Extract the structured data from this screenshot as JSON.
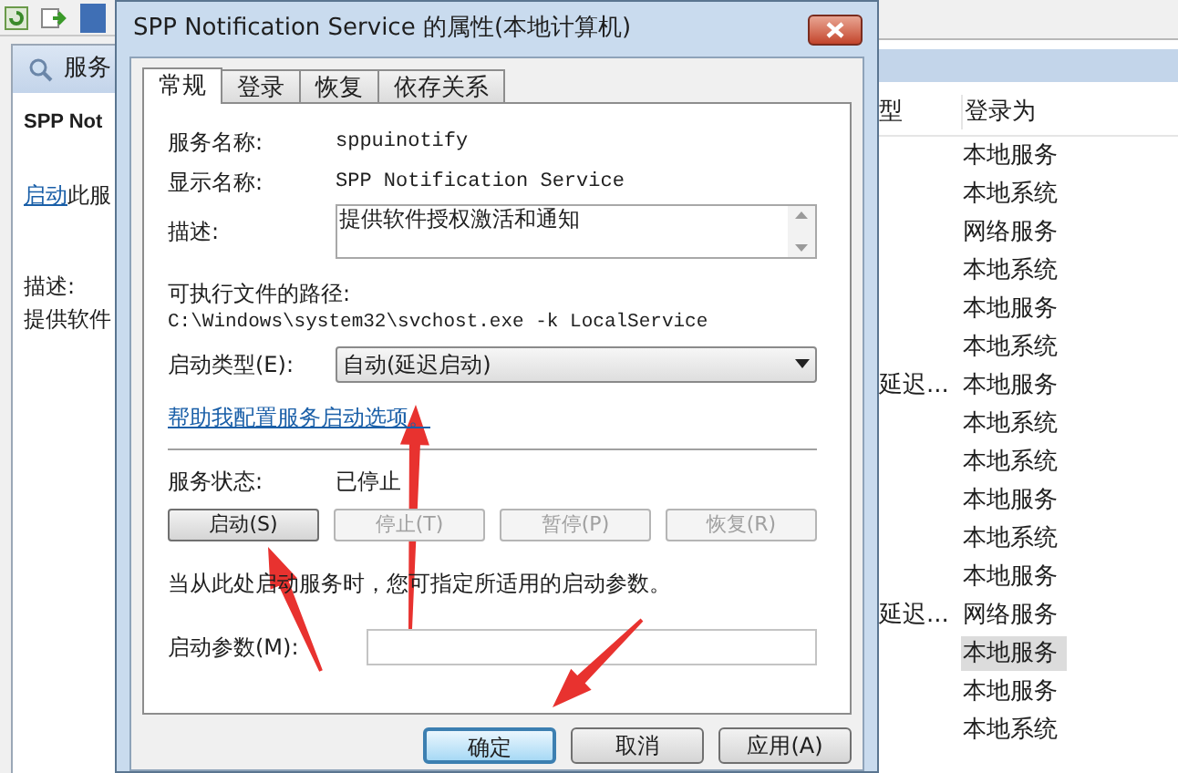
{
  "left_pane": {
    "header": "服务",
    "service_name": "SPP Not",
    "action_link": "启动",
    "action_text": "此服",
    "description_label": "描述:",
    "description_text": "提供软件"
  },
  "dialog": {
    "title": "SPP Notification Service 的属性(本地计算机)",
    "tabs": [
      {
        "label": "常规",
        "selected": true
      },
      {
        "label": "登录",
        "selected": false
      },
      {
        "label": "恢复",
        "selected": false
      },
      {
        "label": "依存关系",
        "selected": false
      }
    ],
    "service_name_label": "服务名称:",
    "service_name": "sppuinotify",
    "display_name_label": "显示名称:",
    "display_name": "SPP Notification Service",
    "description_label": "描述:",
    "description": "提供软件授权激活和通知",
    "path_label": "可执行文件的路径:",
    "path": "C:\\Windows\\system32\\svchost.exe -k LocalService",
    "startup_type_label": "启动类型(E):",
    "startup_type": "自动(延迟启动)",
    "help_link": "帮助我配置服务启动选项。",
    "status_label": "服务状态:",
    "status": "已停止",
    "service_buttons": [
      {
        "label": "启动(S)",
        "disabled": false
      },
      {
        "label": "停止(T)",
        "disabled": true
      },
      {
        "label": "暂停(P)",
        "disabled": true
      },
      {
        "label": "恢复(R)",
        "disabled": true
      }
    ],
    "hint": "当从此处启动服务时，您可指定所适用的启动参数。",
    "params_label": "启动参数(M):",
    "buttons": [
      {
        "label": "确定",
        "default": true
      },
      {
        "label": "取消",
        "default": false
      },
      {
        "label": "应用(A)",
        "default": false
      }
    ]
  },
  "services_list": {
    "columns": [
      "型",
      "登录为"
    ],
    "rows": [
      {
        "startup_type": "",
        "log_on_as": "本地服务",
        "selected": false
      },
      {
        "startup_type": "",
        "log_on_as": "本地系统",
        "selected": false
      },
      {
        "startup_type": "",
        "log_on_as": "网络服务",
        "selected": false
      },
      {
        "startup_type": "",
        "log_on_as": "本地系统",
        "selected": false
      },
      {
        "startup_type": "",
        "log_on_as": "本地服务",
        "selected": false
      },
      {
        "startup_type": "",
        "log_on_as": "本地系统",
        "selected": false
      },
      {
        "startup_type": "延迟...",
        "log_on_as": "本地服务",
        "selected": false
      },
      {
        "startup_type": "",
        "log_on_as": "本地系统",
        "selected": false
      },
      {
        "startup_type": "",
        "log_on_as": "本地系统",
        "selected": false
      },
      {
        "startup_type": "",
        "log_on_as": "本地服务",
        "selected": false
      },
      {
        "startup_type": "",
        "log_on_as": "本地系统",
        "selected": false
      },
      {
        "startup_type": "",
        "log_on_as": "本地服务",
        "selected": false
      },
      {
        "startup_type": "延迟...",
        "log_on_as": "网络服务",
        "selected": false
      },
      {
        "startup_type": "",
        "log_on_as": "本地服务",
        "selected": true
      },
      {
        "startup_type": "",
        "log_on_as": "本地服务",
        "selected": false
      },
      {
        "startup_type": "",
        "log_on_as": "本地系统",
        "selected": false
      }
    ]
  }
}
